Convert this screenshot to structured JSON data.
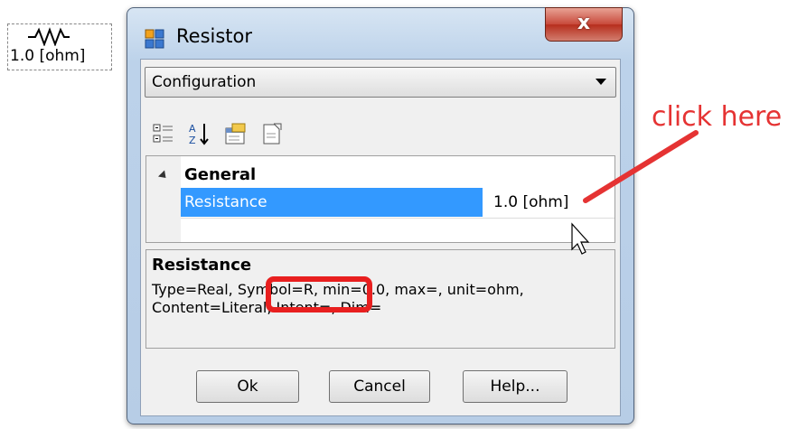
{
  "component": {
    "label": "1.0 [ohm]",
    "icon": "resistor-symbol-icon"
  },
  "window": {
    "title": "Resistor",
    "app_icon": "component-app-icon",
    "close_label": "x"
  },
  "dropdown": {
    "selected": "Configuration"
  },
  "toolbar": {
    "icons": [
      "categorized-icon",
      "alphabetical-sort-icon",
      "property-pages-icon",
      "events-icon"
    ]
  },
  "grid": {
    "category": "General",
    "property": {
      "name": "Resistance",
      "value": "1.0 [ohm]"
    }
  },
  "description": {
    "heading": "Resistance",
    "text": "Type=Real, Symbol=R, min=0.0, max=, unit=ohm, Content=Literal, Intent=, Dim="
  },
  "buttons": {
    "ok": "Ok",
    "cancel": "Cancel",
    "help": "Help..."
  },
  "annotation": {
    "text": "click here",
    "color": "#e53333"
  }
}
